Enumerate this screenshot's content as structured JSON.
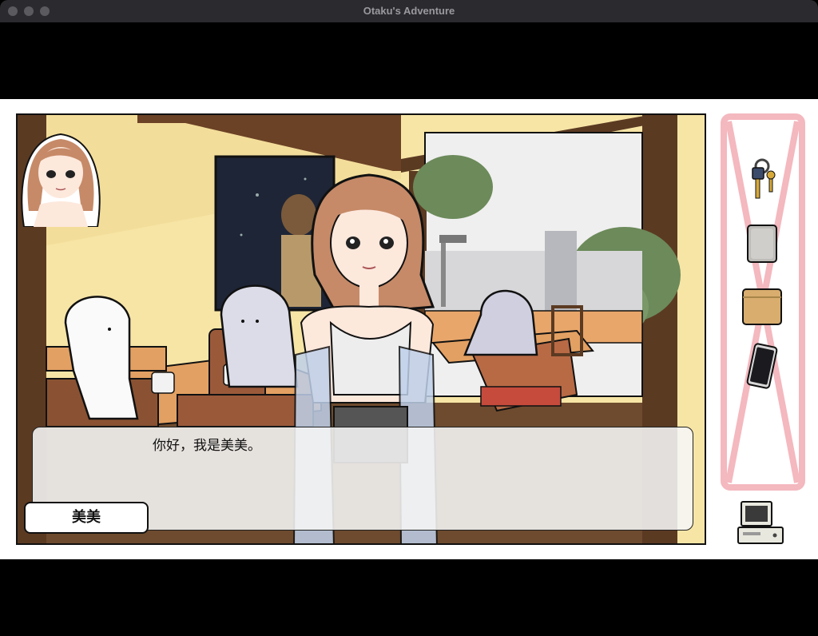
{
  "window": {
    "title": "Otaku's Adventure"
  },
  "dialog": {
    "speaker": "美美",
    "text": "你好，我是美美。"
  },
  "inventory": {
    "items": [
      {
        "icon": "keys-icon"
      },
      {
        "icon": "power-bank-icon"
      },
      {
        "icon": "wallet-icon"
      },
      {
        "icon": "smartphone-icon"
      }
    ]
  },
  "system": {
    "icon": "computer-icon"
  },
  "colors": {
    "wall": "#f7e5a6",
    "wood": "#5b3a22",
    "inventory_frame": "#f4b8bf",
    "chair": "#b86a45"
  }
}
